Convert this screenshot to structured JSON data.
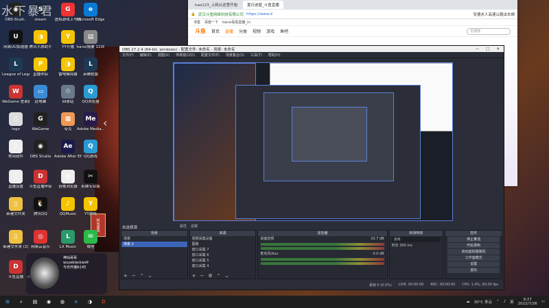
{
  "watermark": "水下暴君",
  "desktop": {
    "icons": [
      {
        "label": "OBS-Studi..",
        "color": "#222",
        "glyph": "◉"
      },
      {
        "label": "steam",
        "color": "#1b2838",
        "glyph": "S"
      },
      {
        "label": "虚拟游戏上号器",
        "color": "#e33",
        "glyph": "G"
      },
      {
        "label": "Microsoft Edge",
        "color": "#0a7bd4",
        "glyph": "e"
      },
      {
        "label": "网易UU加速器",
        "color": "#111",
        "glyph": "U"
      },
      {
        "label": "腾讯手游助手",
        "color": "#f5c400",
        "glyph": "◑"
      },
      {
        "label": "YY开播",
        "color": "#f5c400",
        "glyph": "Y"
      },
      {
        "label": "kanxi报要 1108",
        "color": "#888",
        "glyph": "▤"
      },
      {
        "label": "League of Legends",
        "color": "#1d3a55",
        "glyph": "L"
      },
      {
        "label": "直播伴侣",
        "color": "#f5c400",
        "glyph": "P"
      },
      {
        "label": "雷电模拟器",
        "color": "#f5c400",
        "glyph": "◑"
      },
      {
        "label": "英雄联盟",
        "color": "#1d3a55",
        "glyph": "L"
      },
      {
        "label": "WeGame 登录器",
        "color": "#c33",
        "glyph": "W"
      },
      {
        "label": "此电脑",
        "color": "#3a8ad4",
        "glyph": "▭"
      },
      {
        "label": "回收站",
        "color": "#6a7a8a",
        "glyph": "♲"
      },
      {
        "label": "QQ浏览器",
        "color": "#2a9ad4",
        "glyph": "Q"
      },
      {
        "label": "logo",
        "color": "#ddd",
        "glyph": "▯"
      },
      {
        "label": "WeGame",
        "color": "#222",
        "glyph": "G"
      },
      {
        "label": "夸克",
        "color": "#e95",
        "glyph": "▦"
      },
      {
        "label": "Adobe Media...",
        "color": "#2a1a4a",
        "glyph": "Me"
      },
      {
        "label": "常用软件",
        "color": "#eee",
        "glyph": "▯"
      },
      {
        "label": "OBS Studio",
        "color": "#222",
        "glyph": "◉"
      },
      {
        "label": "Adobe After Effects 2021",
        "color": "#1a1a4a",
        "glyph": "Ae"
      },
      {
        "label": "QQ游戏",
        "color": "#2a9ad4",
        "glyph": "Q"
      },
      {
        "label": "直播设置",
        "color": "#eee",
        "glyph": "▯"
      },
      {
        "label": "斗鱼直播伴侣",
        "color": "#c33",
        "glyph": "D"
      },
      {
        "label": "谷歌浏览器",
        "color": "#eee",
        "glyph": "◍"
      },
      {
        "label": "剪映专业版",
        "color": "#111",
        "glyph": "✂"
      },
      {
        "label": "新建文件夹",
        "color": "#f0c040",
        "glyph": "▯"
      },
      {
        "label": "腾讯QQ",
        "color": "#111",
        "glyph": "🐧"
      },
      {
        "label": "QQMusic",
        "color": "#f5c400",
        "glyph": "♪"
      },
      {
        "label": "YY游戏",
        "color": "#f5c400",
        "glyph": "Y"
      },
      {
        "label": "新建文件夹 (2)",
        "color": "#f0c040",
        "glyph": "▯"
      },
      {
        "label": "网易云音乐",
        "color": "#d33",
        "glyph": "◎"
      },
      {
        "label": "LX Music",
        "color": "#2a9a6a",
        "glyph": "L"
      },
      {
        "label": "微信",
        "color": "#2aba4a",
        "glyph": "✉"
      },
      {
        "label": "斗鱼直播",
        "color": "#c33",
        "glyph": "D"
      },
      {
        "label": "英雄联盟 WeGame版",
        "color": "#1d3a55",
        "glyph": "L"
      }
    ],
    "wallpaper_tag": "时光游戏",
    "wallpaper_arrow": "‹"
  },
  "browser": {
    "tabs": [
      {
        "label": "hao123_上网从这里开始"
      },
      {
        "label": "夏日迷窟_斗鱼直播"
      }
    ],
    "url_secure": "武汉斗鱼网络科技有限公司",
    "url": "https://www.d",
    "right_text": "安德夫人高速公路出车祸",
    "bookmarks": [
      "书签",
      "百度一下",
      "kanxi看看直播_(n"
    ],
    "nav_logo": "斗鱼",
    "nav_items": [
      "首页",
      "直播",
      "分类",
      "视频",
      "游戏",
      "鱼吧"
    ],
    "search_placeholder": "也搜搜"
  },
  "obs": {
    "title": "OBS 27.2.4 (64-bit, windows) - 配置文件: 未命名 - 场景: 未命名",
    "menu": [
      "文件(F)",
      "编辑(E)",
      "视图(V)",
      "停靠窗口(D)",
      "配置文件(P)",
      "场景集合(S)",
      "工具(T)",
      "帮助(H)"
    ],
    "no_source": "未选择源",
    "props_buttons": [
      "属性",
      "滤镜"
    ],
    "scenes": {
      "header": "场景",
      "items": [
        "场景",
        "场景 2"
      ],
      "selected": 1
    },
    "sources": {
      "header": "来源",
      "items": [
        "视频采集设备",
        "图像",
        "窗口采集 7",
        "窗口采集 6",
        "窗口采集 5",
        "窗口采集 4"
      ]
    },
    "mixer": {
      "header": "混音器",
      "tracks": [
        {
          "name": "桌面音频",
          "db": "10.7 dB"
        },
        {
          "name": "麦克风/Aux",
          "db": "0.0 dB"
        }
      ]
    },
    "transition": {
      "header": "转场特效",
      "type": "淡出",
      "duration_label": "时长",
      "duration": "300 ms"
    },
    "controls": {
      "header": "控件",
      "buttons": [
        "停止推流",
        "开始录制",
        "启动虚拟摄像机",
        "工作室模式",
        "设置",
        "退出"
      ]
    },
    "statusbar": [
      "丢帧 0 (0.0%)",
      "LIVE: 00:00:00",
      "REC: 00:00:00",
      "CPU: 1.4%, 60.00 fps"
    ]
  },
  "streamer": {
    "lines": [
      "神仙哥哥",
      "wuyeblackwolf",
      "今日开播8小时"
    ]
  },
  "taskbar": {
    "apps": [
      "⊞",
      "⌕",
      "▤",
      "◉",
      "◍",
      "e",
      "◑",
      "D"
    ],
    "weather": "30°C 多云",
    "time": "9:27",
    "date": "2022/7/26",
    "lang": "英"
  }
}
